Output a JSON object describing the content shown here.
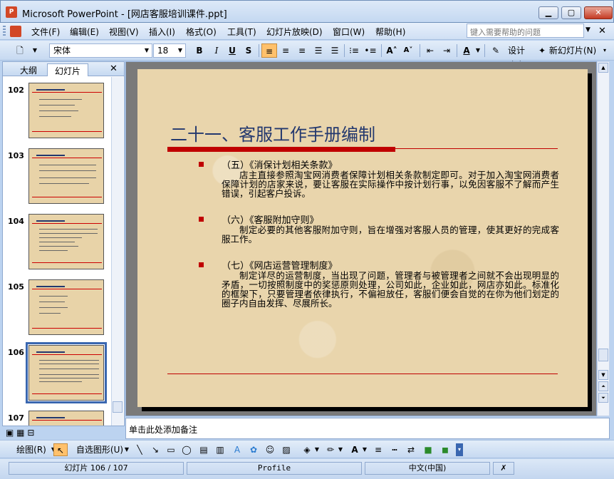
{
  "window": {
    "title": "Microsoft PowerPoint - [网店客服培训课件.ppt]",
    "icon": "powerpoint-icon"
  },
  "menu": {
    "items": [
      "文件(F)",
      "编辑(E)",
      "视图(V)",
      "插入(I)",
      "格式(O)",
      "工具(T)",
      "幻灯片放映(D)",
      "窗口(W)",
      "帮助(H)"
    ],
    "help_placeholder": "键入需要帮助的问题"
  },
  "toolbar": {
    "font": "宋体",
    "size": "18",
    "bold": "B",
    "italic": "I",
    "underline": "U",
    "shadow": "S",
    "design_label": "设计(S)",
    "new_slide_label": "新幻灯片(N)"
  },
  "left_pane": {
    "tabs": [
      "大纲",
      "幻灯片"
    ],
    "active_tab": "幻灯片",
    "slides": [
      "102",
      "103",
      "104",
      "105",
      "106",
      "107"
    ],
    "selected": "106"
  },
  "slide": {
    "title": "二十一、客服工作手册编制",
    "sections": [
      {
        "heading": "（五）《消保计划相关条款》",
        "body": "店主直接参照淘宝网消费者保障计划相关条款制定即可。对于加入淘宝网消费者保障计划的店家来说，要让客服在实际操作中按计划行事，以免因客服不了解而产生错误，引起客户投诉。"
      },
      {
        "heading": "（六）《客服附加守则》",
        "body": "制定必要的其他客服附加守则，旨在增强对客服人员的管理，使其更好的完成客服工作。"
      },
      {
        "heading": "（七）《网店运营管理制度》",
        "body": "制定详尽的运营制度，当出现了问题，管理者与被管理者之间就不会出现明显的矛盾，一切按照制度中的奖惩原则处理，公司如此，企业如此，网店亦如此。标准化的框架下，只要管理者依律执行，不偏袒放任，客服们便会自觉的在你为他们划定的圈子内自由发挥、尽展所长。"
      }
    ],
    "accent_color": "#c00000",
    "title_color": "#23386e"
  },
  "notes": {
    "placeholder": "单击此处添加备注"
  },
  "draw_toolbar": {
    "draw_label": "绘图(R)",
    "autoshapes_label": "自选图形(U)"
  },
  "status": {
    "slide_info": "幻灯片 106 / 107",
    "template": "Profile",
    "language": "中文(中国)"
  }
}
